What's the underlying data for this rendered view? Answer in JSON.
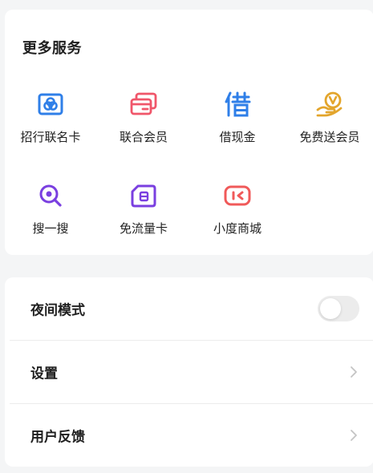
{
  "services": {
    "title": "更多服务",
    "items": [
      {
        "label": "招行联名卡",
        "icon": "bank-card-icon",
        "color": "#2f7fe8"
      },
      {
        "label": "联合会员",
        "icon": "member-cards-icon",
        "color": "#f0566a"
      },
      {
        "label": "借现金",
        "icon": "borrow-char-icon",
        "color": "#2f7fe8"
      },
      {
        "label": "免费送会员",
        "icon": "vip-hand-icon",
        "color": "#e3a52c"
      },
      {
        "label": "搜一搜",
        "icon": "search-icon",
        "color": "#7a3fe0"
      },
      {
        "label": "免流量卡",
        "icon": "sim-card-icon",
        "color": "#7a3fe0"
      },
      {
        "label": "小度商城",
        "icon": "shop-icon",
        "color": "#f05a5a"
      }
    ]
  },
  "settings": {
    "night_mode_label": "夜间模式",
    "night_mode_on": false,
    "settings_label": "设置",
    "feedback_label": "用户反馈"
  },
  "colors": {
    "background": "#f4f5f6",
    "card": "#ffffff",
    "toggle_off": "#ececec",
    "chevron": "#c4c4c4"
  }
}
